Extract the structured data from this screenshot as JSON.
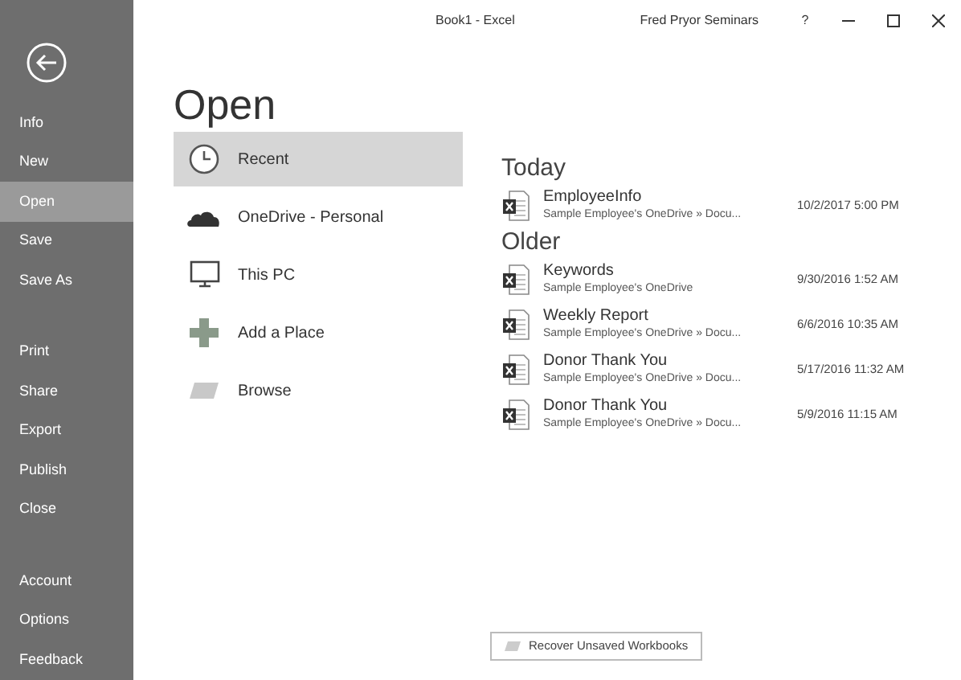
{
  "window": {
    "title": "Book1 - Excel",
    "user": "Fred Pryor Seminars",
    "help": "?"
  },
  "sidebar": {
    "groups": [
      {
        "items": [
          {
            "label": "Info",
            "selected": false
          },
          {
            "label": "New",
            "selected": false
          },
          {
            "label": "Open",
            "selected": true
          },
          {
            "label": "Save",
            "selected": false
          },
          {
            "label": "Save As",
            "selected": false
          }
        ]
      },
      {
        "items": [
          {
            "label": "Print",
            "selected": false
          },
          {
            "label": "Share",
            "selected": false
          },
          {
            "label": "Export",
            "selected": false
          },
          {
            "label": "Publish",
            "selected": false
          },
          {
            "label": "Close",
            "selected": false
          }
        ]
      },
      {
        "items": [
          {
            "label": "Account",
            "selected": false
          },
          {
            "label": "Options",
            "selected": false
          },
          {
            "label": "Feedback",
            "selected": false
          }
        ]
      }
    ]
  },
  "page_title": "Open",
  "places": [
    {
      "kind": "recent",
      "label": "Recent",
      "selected": true
    },
    {
      "kind": "cloud",
      "label": "OneDrive - Personal",
      "selected": false
    },
    {
      "kind": "pc",
      "label": "This PC",
      "selected": false
    },
    {
      "kind": "add",
      "label": "Add a Place",
      "selected": false
    },
    {
      "kind": "browse",
      "label": "Browse",
      "selected": false
    }
  ],
  "recent": [
    {
      "heading": "Today",
      "files": [
        {
          "name": "EmployeeInfo",
          "path": "Sample Employee's OneDrive » Docu...",
          "date": "10/2/2017 5:00 PM"
        }
      ]
    },
    {
      "heading": "Older",
      "files": [
        {
          "name": "Keywords",
          "path": "Sample Employee's OneDrive",
          "date": "9/30/2016 1:52 AM"
        },
        {
          "name": "Weekly Report",
          "path": "Sample Employee's OneDrive » Docu...",
          "date": "6/6/2016 10:35 AM"
        },
        {
          "name": "Donor Thank You",
          "path": "Sample Employee's OneDrive » Docu...",
          "date": "5/17/2016 11:32 AM"
        },
        {
          "name": "Donor Thank You",
          "path": "Sample Employee's OneDrive » Docu...",
          "date": "5/9/2016 11:15 AM"
        }
      ]
    }
  ],
  "recover_button": "Recover Unsaved Workbooks"
}
